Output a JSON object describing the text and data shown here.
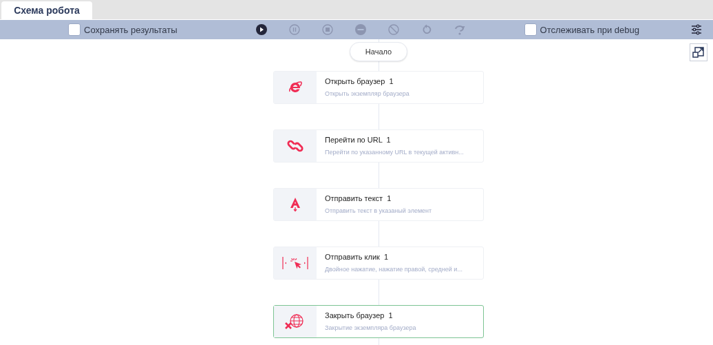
{
  "tabs": [
    {
      "label": "Схема робота",
      "selected": true
    }
  ],
  "toolbar": {
    "save_results": {
      "label": "Сохранять результаты",
      "checked": false
    },
    "buttons": [
      {
        "kind": "play",
        "disabled": false
      },
      {
        "kind": "pause",
        "disabled": true
      },
      {
        "kind": "stop",
        "disabled": true
      },
      {
        "kind": "minus",
        "disabled": true
      },
      {
        "kind": "block",
        "disabled": true
      },
      {
        "kind": "restart",
        "disabled": true
      },
      {
        "kind": "step",
        "disabled": true
      }
    ],
    "track_debug": {
      "label": "Отслеживать при debug",
      "checked": false
    }
  },
  "canvas": {
    "start": "Начало",
    "steps": [
      {
        "kind": "browser",
        "title": "Открыть браузер",
        "count": "1",
        "description": "Открыть экземпляр браузера",
        "selected": false
      },
      {
        "kind": "link",
        "title": "Перейти по URL",
        "count": "1",
        "description": "Перейти по указанному URL в текущей активн...",
        "selected": false
      },
      {
        "kind": "text",
        "title": "Отправить текст",
        "count": "1",
        "description": "Отправить текст в указаный элемент",
        "selected": false
      },
      {
        "kind": "click",
        "title": "Отправить клик",
        "count": "1",
        "description": "Двойное нажатие, нажатие правой, средней и...",
        "selected": false
      },
      {
        "kind": "close",
        "title": "Закрыть браузер",
        "count": "1",
        "description": "Закрытие экземпляра браузера",
        "selected": true
      }
    ]
  }
}
